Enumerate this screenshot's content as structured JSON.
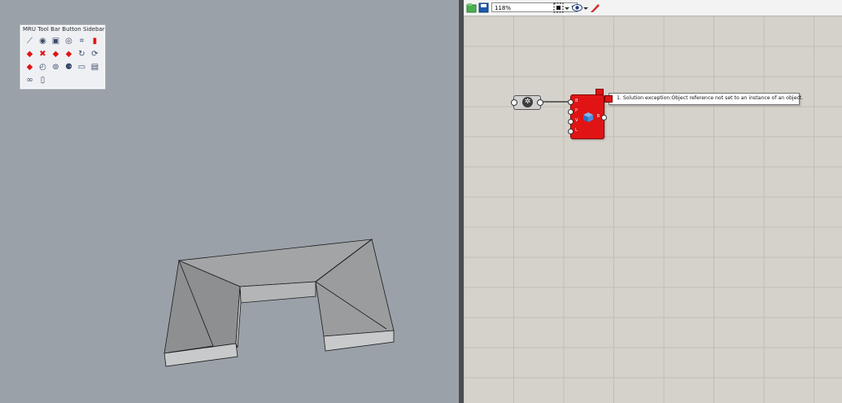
{
  "toolbar": {
    "title": "MRU Tool Bar Button Sidebar",
    "tools": [
      {
        "icon": "polyline-icon",
        "glyph": "⟋"
      },
      {
        "icon": "render-sphere-icon",
        "glyph": "◉"
      },
      {
        "icon": "box-icon",
        "glyph": "▣"
      },
      {
        "icon": "boolean-union-icon",
        "glyph": "◎"
      },
      {
        "icon": "control-points-icon",
        "glyph": "⌗"
      },
      {
        "icon": "red-cylinder-icon",
        "glyph": "▮"
      },
      {
        "icon": "red-car-icon",
        "glyph": "◆"
      },
      {
        "icon": "red-car-icon",
        "glyph": "✖"
      },
      {
        "icon": "red-car-icon",
        "glyph": "◆"
      },
      {
        "icon": "red-car-icon",
        "glyph": "◆"
      },
      {
        "icon": "cycle-icon",
        "glyph": "↻"
      },
      {
        "icon": "rotate-icon",
        "glyph": "⟳"
      },
      {
        "icon": "red-car-icon",
        "glyph": "◆"
      },
      {
        "icon": "measure-angle-icon",
        "glyph": "◴"
      },
      {
        "icon": "dial-icon",
        "glyph": "⊚"
      },
      {
        "icon": "spheres-icon",
        "glyph": "⚈"
      },
      {
        "icon": "open-folder-icon",
        "glyph": "▭"
      },
      {
        "icon": "save-icon",
        "glyph": "▤"
      },
      {
        "icon": "group-icon",
        "glyph": "∞"
      },
      {
        "icon": "new-document-icon",
        "glyph": "▯"
      }
    ]
  },
  "gh_toolbar": {
    "zoom": "118%"
  },
  "component": {
    "inputs": [
      "B",
      "P",
      "V",
      "L"
    ],
    "output": "B"
  },
  "error_tooltip": {
    "text": "1. Solution exception:Object reference not set to an instance of an object."
  },
  "colors": {
    "viewport_bg": "#9aa1a9",
    "canvas_bg": "#d5d2cb",
    "error_red": "#e01414"
  }
}
